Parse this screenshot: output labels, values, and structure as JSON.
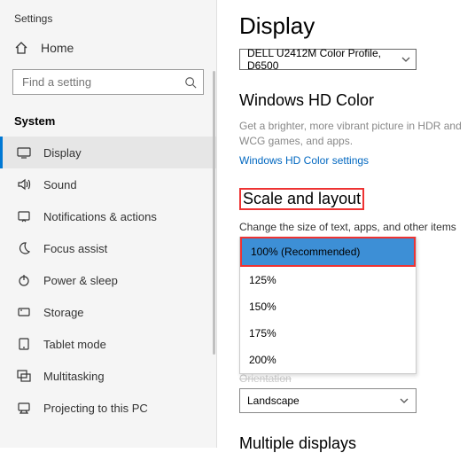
{
  "window_title": "Settings",
  "home_label": "Home",
  "search": {
    "placeholder": "Find a setting"
  },
  "section": "System",
  "nav": [
    {
      "label": "Display",
      "icon": "display-icon",
      "selected": true
    },
    {
      "label": "Sound",
      "icon": "sound-icon"
    },
    {
      "label": "Notifications & actions",
      "icon": "notifications-icon"
    },
    {
      "label": "Focus assist",
      "icon": "moon-icon"
    },
    {
      "label": "Power & sleep",
      "icon": "power-icon"
    },
    {
      "label": "Storage",
      "icon": "storage-icon"
    },
    {
      "label": "Tablet mode",
      "icon": "tablet-icon"
    },
    {
      "label": "Multitasking",
      "icon": "multitasking-icon"
    },
    {
      "label": "Projecting to this PC",
      "icon": "projecting-icon"
    }
  ],
  "page": {
    "title": "Display",
    "color_profile": "DELL U2412M Color Profile, D6500",
    "hd_heading": "Windows HD Color",
    "hd_desc": "Get a brighter, more vibrant picture in HDR and WCG games, and apps.",
    "hd_link": "Windows HD Color settings",
    "scale_heading": "Scale and layout",
    "scale_label": "Change the size of text, apps, and other items",
    "scale_options": [
      {
        "label": "100% (Recommended)",
        "selected": true
      },
      {
        "label": "125%"
      },
      {
        "label": "150%"
      },
      {
        "label": "175%"
      },
      {
        "label": "200%"
      }
    ],
    "orientation_label_covered": "Orientation",
    "orientation_value": "Landscape",
    "multiple_heading": "Multiple displays"
  }
}
